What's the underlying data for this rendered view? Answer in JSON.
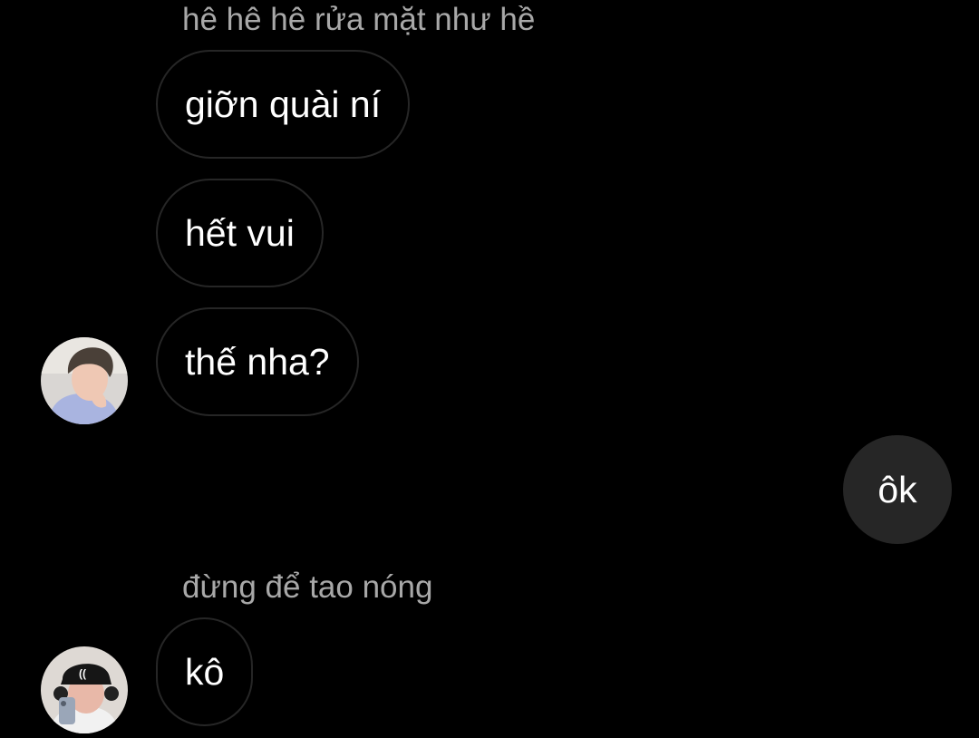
{
  "thread": {
    "reply_label_1": "hê hê hê rửa mặt như hề",
    "message_1": "giỡn quài ní",
    "message_2": "hết vui",
    "message_3": "thế nha?",
    "sent_message": "ôk",
    "reply_label_2": "đừng để tao nóng",
    "message_4": "kô"
  },
  "avatars": {
    "contact_1": "person-photo-avatar",
    "contact_2": "person-with-cap-avatar"
  },
  "colors": {
    "background": "#000000",
    "incoming_border": "#262626",
    "outgoing_fill": "#262626",
    "text": "#ffffff",
    "muted_text": "#a8a8a8"
  }
}
